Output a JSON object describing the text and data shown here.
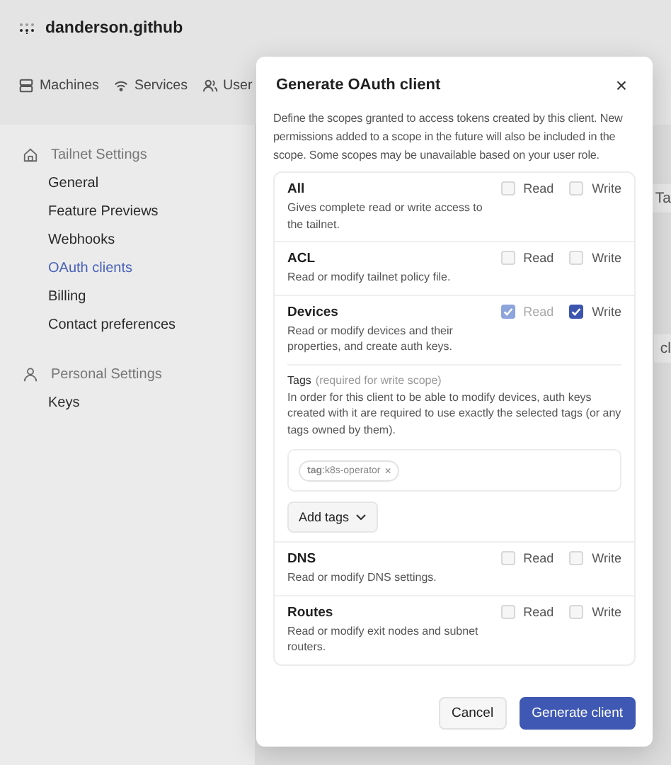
{
  "brand": {
    "name": "danderson.github"
  },
  "nav": [
    {
      "label": "Machines",
      "kind": "machines"
    },
    {
      "label": "Services",
      "kind": "services"
    },
    {
      "label": "User",
      "kind": "users"
    }
  ],
  "sidebar": {
    "sections": [
      {
        "title": "Tailnet Settings",
        "kind": "home",
        "items": [
          {
            "label": "General",
            "selected": false
          },
          {
            "label": "Feature Previews",
            "selected": false
          },
          {
            "label": "Webhooks",
            "selected": false
          },
          {
            "label": "OAuth clients",
            "selected": true
          },
          {
            "label": "Billing",
            "selected": false
          },
          {
            "label": "Contact preferences",
            "selected": false
          }
        ]
      },
      {
        "title": "Personal Settings",
        "kind": "person",
        "items": [
          {
            "label": "Keys",
            "selected": false
          }
        ]
      }
    ]
  },
  "background_fragments": [
    "Ta",
    "cl"
  ],
  "dialog": {
    "title": "Generate OAuth client",
    "close": "×",
    "description": "Define the scopes granted to access tokens created by this client. New permissions added to a scope in the future will also be included in the scope. Some scopes may be unavailable based on your user role.",
    "scopes": [
      {
        "name": "All",
        "description": "Gives complete read or write access to the tailnet.",
        "read": {
          "label": "Read",
          "checked": false,
          "disabled": false
        },
        "write": {
          "label": "Write",
          "checked": false,
          "disabled": false
        }
      },
      {
        "name": "ACL",
        "description": "Read or modify tailnet policy file.",
        "read": {
          "label": "Read",
          "checked": false,
          "disabled": false
        },
        "write": {
          "label": "Write",
          "checked": false,
          "disabled": false
        }
      },
      {
        "name": "Devices",
        "description": "Read or modify devices and their properties, and create auth keys.",
        "read": {
          "label": "Read",
          "checked": true,
          "disabled": true
        },
        "write": {
          "label": "Write",
          "checked": true,
          "disabled": false
        },
        "tags": {
          "label": "Tags",
          "hint": "(required for write scope)",
          "description": "In order for this client to be able to modify devices, auth keys created with it are required to use exactly the selected tags (or any tags owned by them).",
          "chips": [
            {
              "text": "**tag**:k8s-operator",
              "remove": "×"
            }
          ],
          "add_button": "Add tags"
        }
      },
      {
        "name": "DNS",
        "description": "Read or modify DNS settings.",
        "read": {
          "label": "Read",
          "checked": false,
          "disabled": false
        },
        "write": {
          "label": "Write",
          "checked": false,
          "disabled": false
        }
      },
      {
        "name": "Routes",
        "description": "Read or modify exit nodes and subnet routers.",
        "read": {
          "label": "Read",
          "checked": false,
          "disabled": false
        },
        "write": {
          "label": "Write",
          "checked": false,
          "disabled": false
        }
      }
    ],
    "buttons": [
      {
        "label": "Cancel",
        "kind": "secondary"
      },
      {
        "label": "Generate client",
        "kind": "primary"
      }
    ]
  }
}
